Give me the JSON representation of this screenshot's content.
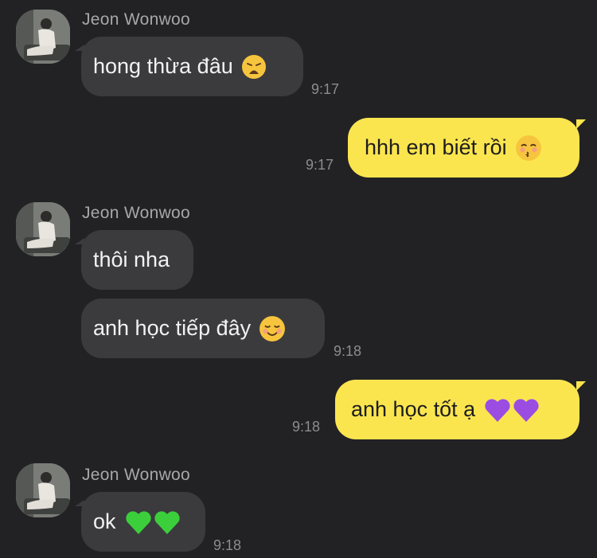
{
  "messages": [
    {
      "sender": "Jeon Wonwoo",
      "text": "hong thừa đâu",
      "emoji": "weary-face-emoji",
      "time": "9:17"
    },
    {
      "text": "hhh em biết rồi",
      "emoji": "kissing-face-emoji",
      "time": "9:17"
    },
    {
      "sender": "Jeon Wonwoo",
      "text": "thôi nha"
    },
    {
      "text": "anh học tiếp đây",
      "emoji": "smiling-face-emoji",
      "time": "9:18"
    },
    {
      "text": "anh học tốt ạ",
      "emoji": "purple-heart-emoji",
      "time": "9:18"
    },
    {
      "sender": "Jeon Wonwoo",
      "text": "ok",
      "emoji": "green-heart-emoji",
      "time": "9:18"
    }
  ],
  "colors": {
    "background": "#222224",
    "incoming_bubble": "#3b3b3e",
    "outgoing_bubble": "#fbe54f",
    "purple_heart": "#9b4de2",
    "green_heart": "#3ccf3c"
  }
}
